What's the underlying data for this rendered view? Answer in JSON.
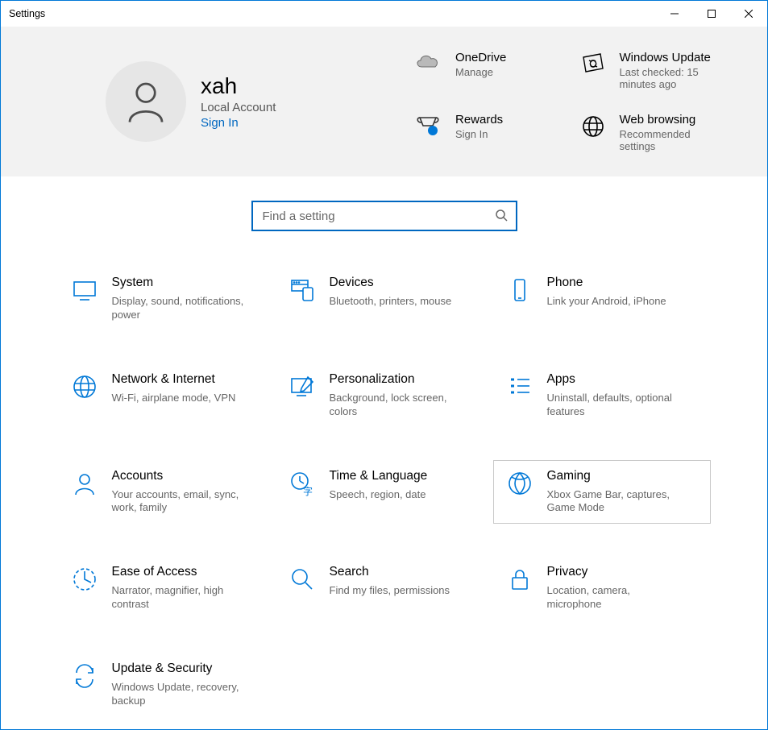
{
  "window": {
    "title": "Settings"
  },
  "profile": {
    "name": "xah",
    "subtitle": "Local Account",
    "signin_label": "Sign In"
  },
  "quick_links": {
    "onedrive": {
      "title": "OneDrive",
      "sub": "Manage"
    },
    "update": {
      "title": "Windows Update",
      "sub": "Last checked: 15 minutes ago"
    },
    "rewards": {
      "title": "Rewards",
      "sub": "Sign In"
    },
    "browsing": {
      "title": "Web browsing",
      "sub": "Recommended settings"
    }
  },
  "search": {
    "placeholder": "Find a setting"
  },
  "categories": {
    "system": {
      "title": "System",
      "sub": "Display, sound, notifications, power"
    },
    "devices": {
      "title": "Devices",
      "sub": "Bluetooth, printers, mouse"
    },
    "phone": {
      "title": "Phone",
      "sub": "Link your Android, iPhone"
    },
    "network": {
      "title": "Network & Internet",
      "sub": "Wi-Fi, airplane mode, VPN"
    },
    "personalization": {
      "title": "Personalization",
      "sub": "Background, lock screen, colors"
    },
    "apps": {
      "title": "Apps",
      "sub": "Uninstall, defaults, optional features"
    },
    "accounts": {
      "title": "Accounts",
      "sub": "Your accounts, email, sync, work, family"
    },
    "time": {
      "title": "Time & Language",
      "sub": "Speech, region, date"
    },
    "gaming": {
      "title": "Gaming",
      "sub": "Xbox Game Bar, captures, Game Mode"
    },
    "ease": {
      "title": "Ease of Access",
      "sub": "Narrator, magnifier, high contrast"
    },
    "searchcat": {
      "title": "Search",
      "sub": "Find my files, permissions"
    },
    "privacy": {
      "title": "Privacy",
      "sub": "Location, camera, microphone"
    },
    "updatesec": {
      "title": "Update & Security",
      "sub": "Windows Update, recovery, backup"
    }
  }
}
